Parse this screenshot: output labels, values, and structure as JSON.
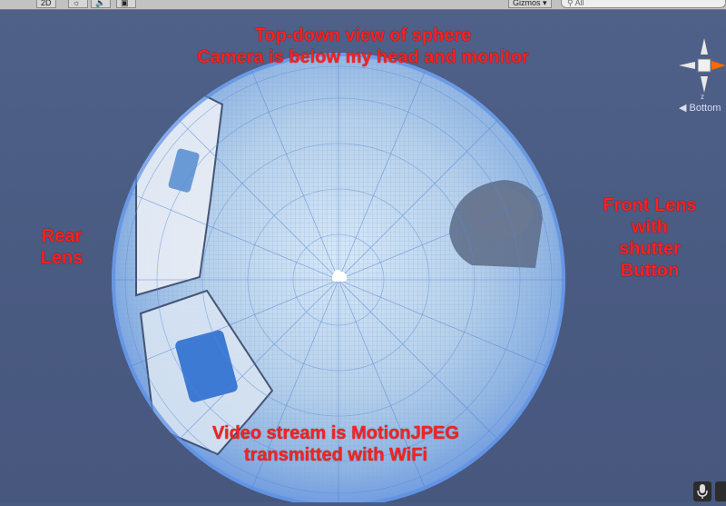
{
  "toolbar": {
    "mode_2d": "2D",
    "light_icon": "sun-icon",
    "audio_icon": "speaker-icon",
    "fx_icon": "image-icon",
    "gizmos_label": "Gizmos",
    "search_placeholder": "All"
  },
  "annotations": {
    "title_line1": "Top-down view of sphere",
    "title_line2": "Camera is below my head and monitor",
    "rear_line1": "Rear",
    "rear_line2": "Lens",
    "front_line1": "Front Lens",
    "front_line2": "with",
    "front_line3": "shutter",
    "front_line4": "Button",
    "bottom_line1": "Video stream is MotionJPEG",
    "bottom_line2": "transmitted with WiFi"
  },
  "gizmo": {
    "view_label": "Bottom",
    "axis_label": "z"
  },
  "colors": {
    "scene_bg": "#4a5b82",
    "annotation": "#ff2020",
    "sphere_fill": "#b7d3ee",
    "wire": "#5e8fdc"
  }
}
